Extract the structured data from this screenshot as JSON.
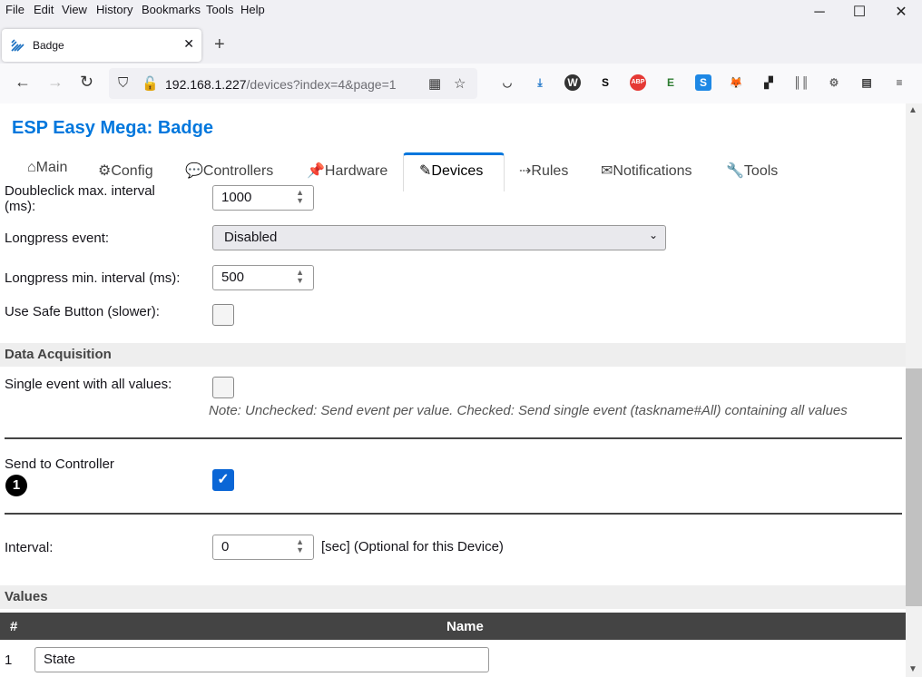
{
  "menubar": [
    "File",
    "Edit",
    "View",
    "History",
    "Bookmarks",
    "Tools",
    "Help"
  ],
  "browser": {
    "tab_title": "Badge",
    "url_host": "192.168.1.227",
    "url_path": "/devices?index=4&page=1"
  },
  "toolbar_icons": [
    "pocket-icon",
    "download-icon",
    "w-extension-icon",
    "s-extension-icon",
    "adblock-icon",
    "e-extension-icon",
    "s-blue-extension-icon",
    "metamask-icon",
    "grid-extension-icon",
    "fence-extension-icon",
    "gear-extension-icon",
    "reader-icon",
    "app-menu-icon"
  ],
  "page": {
    "title": "ESP Easy Mega: Badge",
    "nav": [
      {
        "icon": "⌂",
        "label": "Main"
      },
      {
        "icon": "⚙",
        "label": "Config"
      },
      {
        "icon": "💬",
        "label": "Controllers"
      },
      {
        "icon": "📌",
        "label": "Hardware"
      },
      {
        "icon": "✎",
        "label": "Devices"
      },
      {
        "icon": "⇢",
        "label": "Rules"
      },
      {
        "icon": "✉",
        "label": "Notifications"
      },
      {
        "icon": "🔧",
        "label": "Tools"
      }
    ],
    "active_tab": "Devices"
  },
  "form": {
    "doubleclick_label": "Doubleclick max. interval (ms):",
    "doubleclick_value": "1000",
    "longpress_event_label": "Longpress event:",
    "longpress_event_value": "Disabled",
    "longpress_interval_label": "Longpress min. interval (ms):",
    "longpress_interval_value": "500",
    "safe_button_label": "Use Safe Button (slower):",
    "safe_button_checked": false,
    "data_acquisition_header": "Data Acquisition",
    "single_event_label": "Single event with all values:",
    "single_event_checked": false,
    "single_event_note": "Note: Unchecked: Send event per value. Checked: Send single event (taskname#All) containing all values",
    "send_controller_label": "Send to Controller",
    "controller_number": "1",
    "send_controller_checked": true,
    "interval_label": "Interval:",
    "interval_value": "0",
    "interval_unit": "[sec] (Optional for this Device)"
  },
  "values": {
    "header": "Values",
    "columns": [
      "#",
      "Name"
    ],
    "rows": [
      {
        "num": "1",
        "name": "State"
      }
    ]
  }
}
